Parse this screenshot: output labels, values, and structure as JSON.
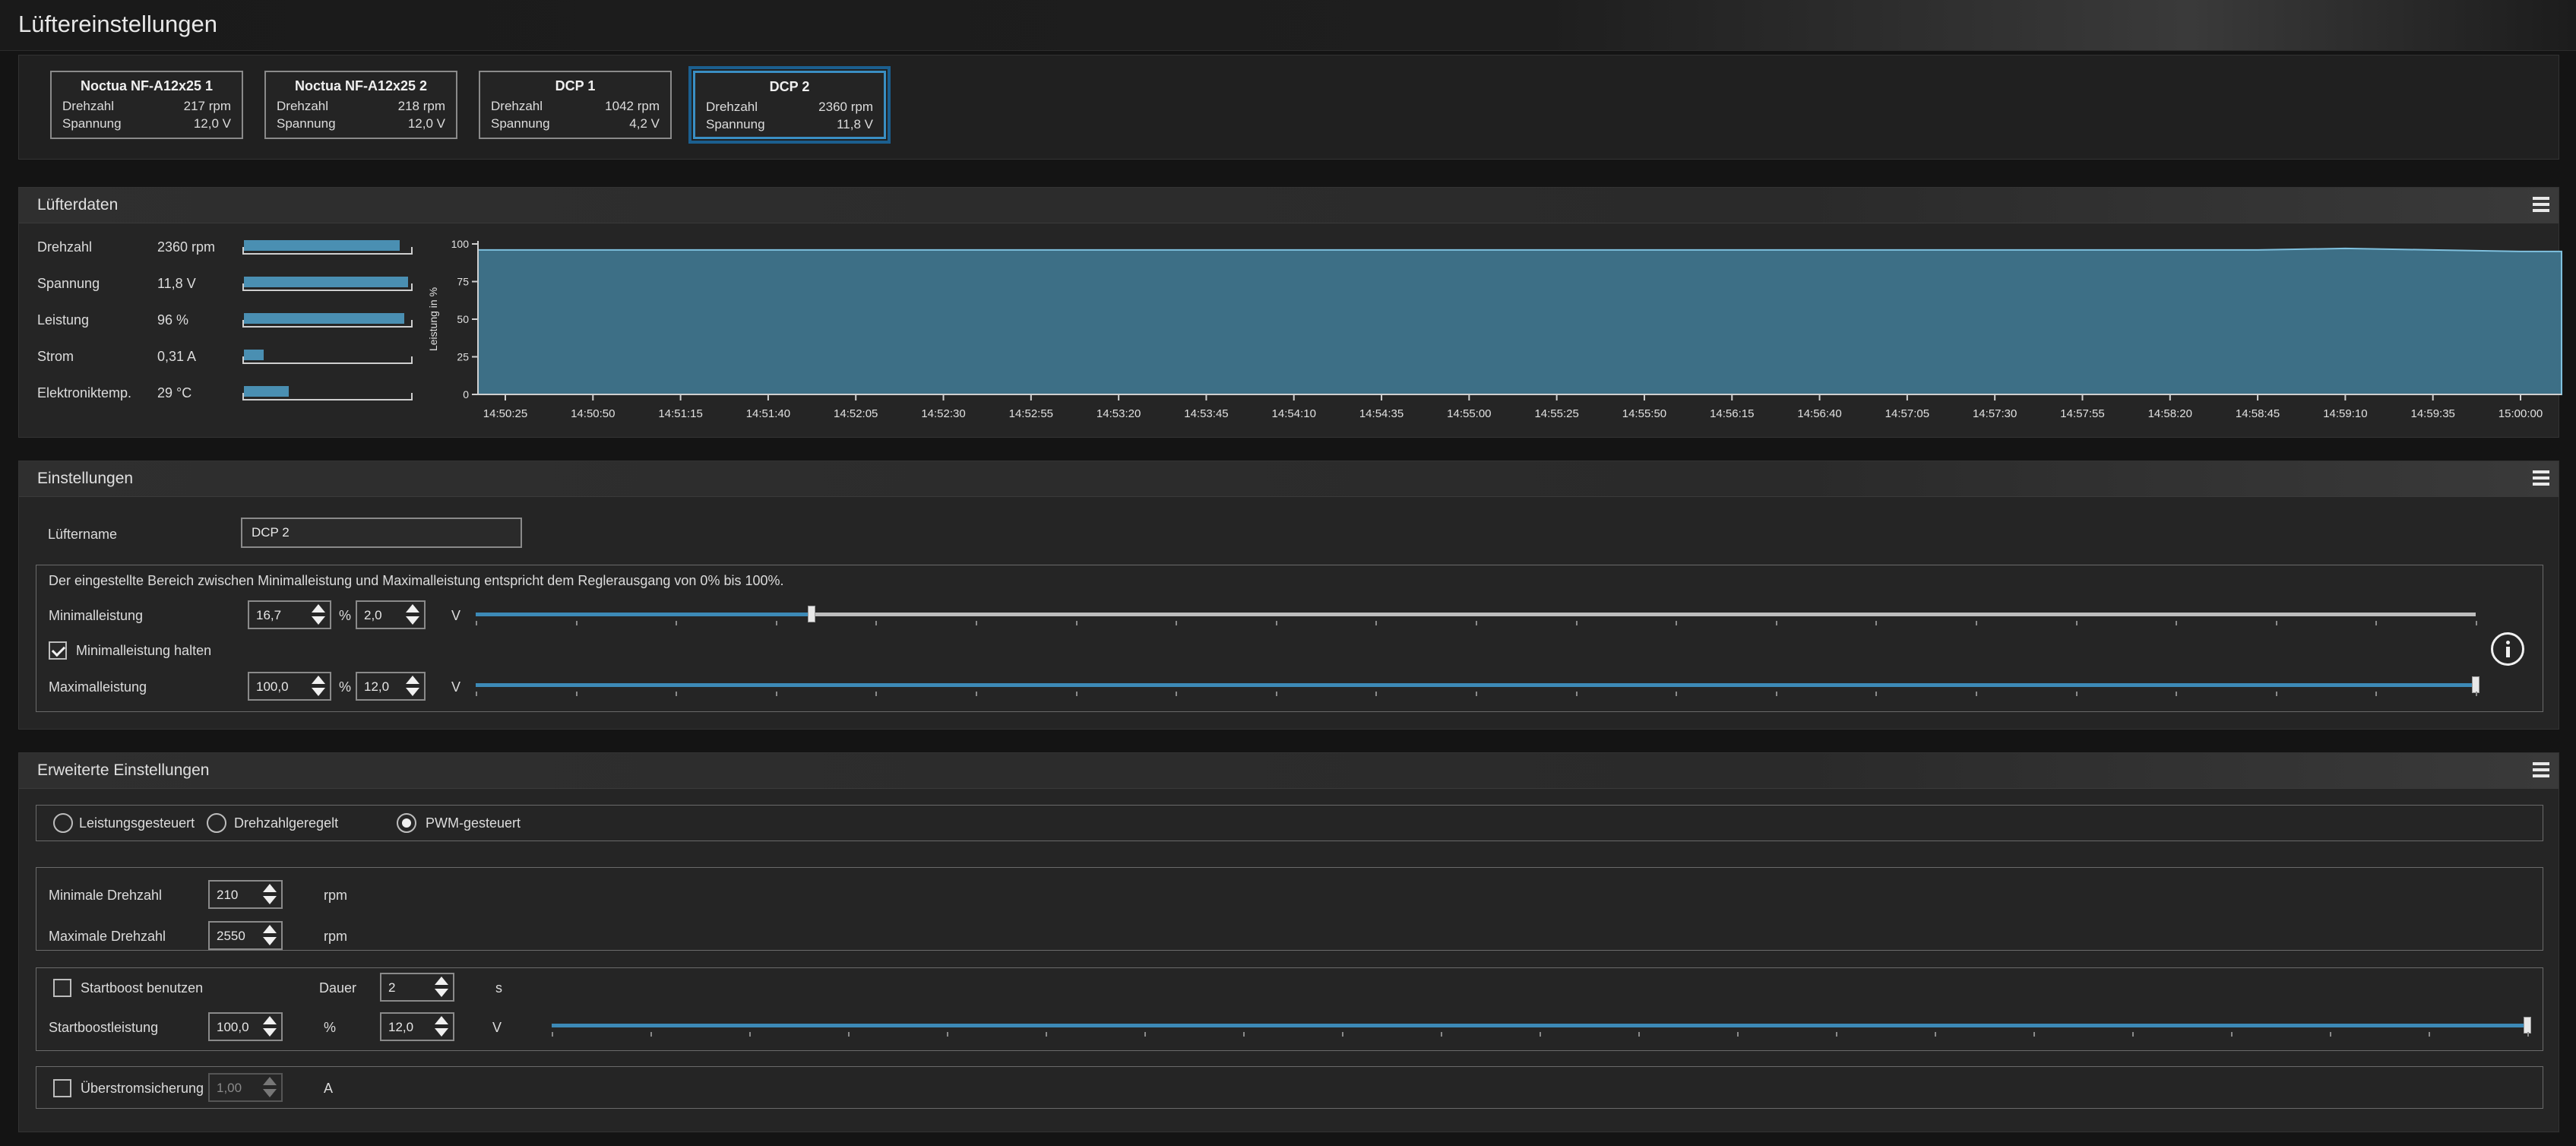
{
  "window": {
    "title": "Lüftereinstellungen"
  },
  "fans": [
    {
      "name": "Noctua NF-A12x25 1",
      "speed_label": "Drehzahl",
      "speed": "217 rpm",
      "voltage_label": "Spannung",
      "voltage": "12,0 V",
      "selected": false
    },
    {
      "name": "Noctua NF-A12x25 2",
      "speed_label": "Drehzahl",
      "speed": "218 rpm",
      "voltage_label": "Spannung",
      "voltage": "12,0 V",
      "selected": false
    },
    {
      "name": "DCP 1",
      "speed_label": "Drehzahl",
      "speed": "1042 rpm",
      "voltage_label": "Spannung",
      "voltage": "4,2 V",
      "selected": false
    },
    {
      "name": "DCP 2",
      "speed_label": "Drehzahl",
      "speed": "2360 rpm",
      "voltage_label": "Spannung",
      "voltage": "11,8 V",
      "selected": true
    }
  ],
  "data_panel": {
    "title": "Lüfterdaten",
    "rows": [
      {
        "label": "Drehzahl",
        "value": "2360 rpm",
        "level": 0.93
      },
      {
        "label": "Spannung",
        "value": "11,8 V",
        "level": 0.98
      },
      {
        "label": "Leistung",
        "value": "96 %",
        "level": 0.96
      },
      {
        "label": "Strom",
        "value": "0,31 A",
        "level": 0.12
      },
      {
        "label": "Elektroniktemp.",
        "value": "29 °C",
        "level": 0.27
      }
    ]
  },
  "chart_data": {
    "type": "area",
    "ylabel": "Leistung in %",
    "xlabel": "",
    "ylim": [
      0,
      100
    ],
    "yticks": [
      "0",
      "25",
      "50",
      "75",
      "100"
    ],
    "x": [
      "14:50:25",
      "14:50:50",
      "14:51:15",
      "14:51:40",
      "14:52:05",
      "14:52:30",
      "14:52:55",
      "14:53:20",
      "14:53:45",
      "14:54:10",
      "14:54:35",
      "14:55:00",
      "14:55:25",
      "14:55:50",
      "14:56:15",
      "14:56:40",
      "14:57:05",
      "14:57:30",
      "14:57:55",
      "14:58:20",
      "14:58:45",
      "14:59:10",
      "14:59:35",
      "15:00:00"
    ],
    "series": [
      {
        "values": [
          96,
          96,
          96,
          96,
          96,
          96,
          96,
          96,
          96,
          96,
          96,
          96,
          96,
          96,
          96,
          96,
          96,
          96,
          96,
          96,
          96,
          97,
          96,
          95
        ]
      }
    ],
    "color": "#3d6f86",
    "grid": false
  },
  "settings": {
    "title": "Einstellungen",
    "name_label": "Lüftername",
    "name_value": "DCP 2",
    "range_note": "Der eingestellte Bereich zwischen Minimalleistung und Maximalleistung entspricht dem Reglerausgang von 0% bis 100%.",
    "min_label": "Minimalleistung",
    "min_percent": "16,7",
    "min_voltage": "2,0",
    "min_level": 0.168,
    "percent_unit": "%",
    "volt_unit": "V",
    "hold_min_label": "Minimalleistung halten",
    "hold_min_checked": true,
    "max_label": "Maximalleistung",
    "max_percent": "100,0",
    "max_voltage": "12,0",
    "max_level": 1.0
  },
  "advanced": {
    "title": "Erweiterte Einstellungen",
    "modes": [
      {
        "label": "Leistungsgesteuert",
        "selected": false
      },
      {
        "label": "Drehzahlgeregelt",
        "selected": false
      },
      {
        "label": "PWM-gesteuert",
        "selected": true
      }
    ],
    "min_rpm_label": "Minimale Drehzahl",
    "min_rpm": "210",
    "max_rpm_label": "Maximale Drehzahl",
    "max_rpm": "2550",
    "rpm_unit": "rpm",
    "startboost_label": "Startboost benutzen",
    "startboost_checked": false,
    "duration_label": "Dauer",
    "duration": "2",
    "seconds_unit": "s",
    "boost_power_label": "Startboostleistung",
    "boost_percent": "100,0",
    "percent_unit": "%",
    "boost_voltage": "12,0",
    "volt_unit": "V",
    "boost_level": 1.0,
    "overcurrent_label": "Überstromsicherung",
    "overcurrent_checked": false,
    "overcurrent_value": "1,00",
    "amp_unit": "A"
  }
}
